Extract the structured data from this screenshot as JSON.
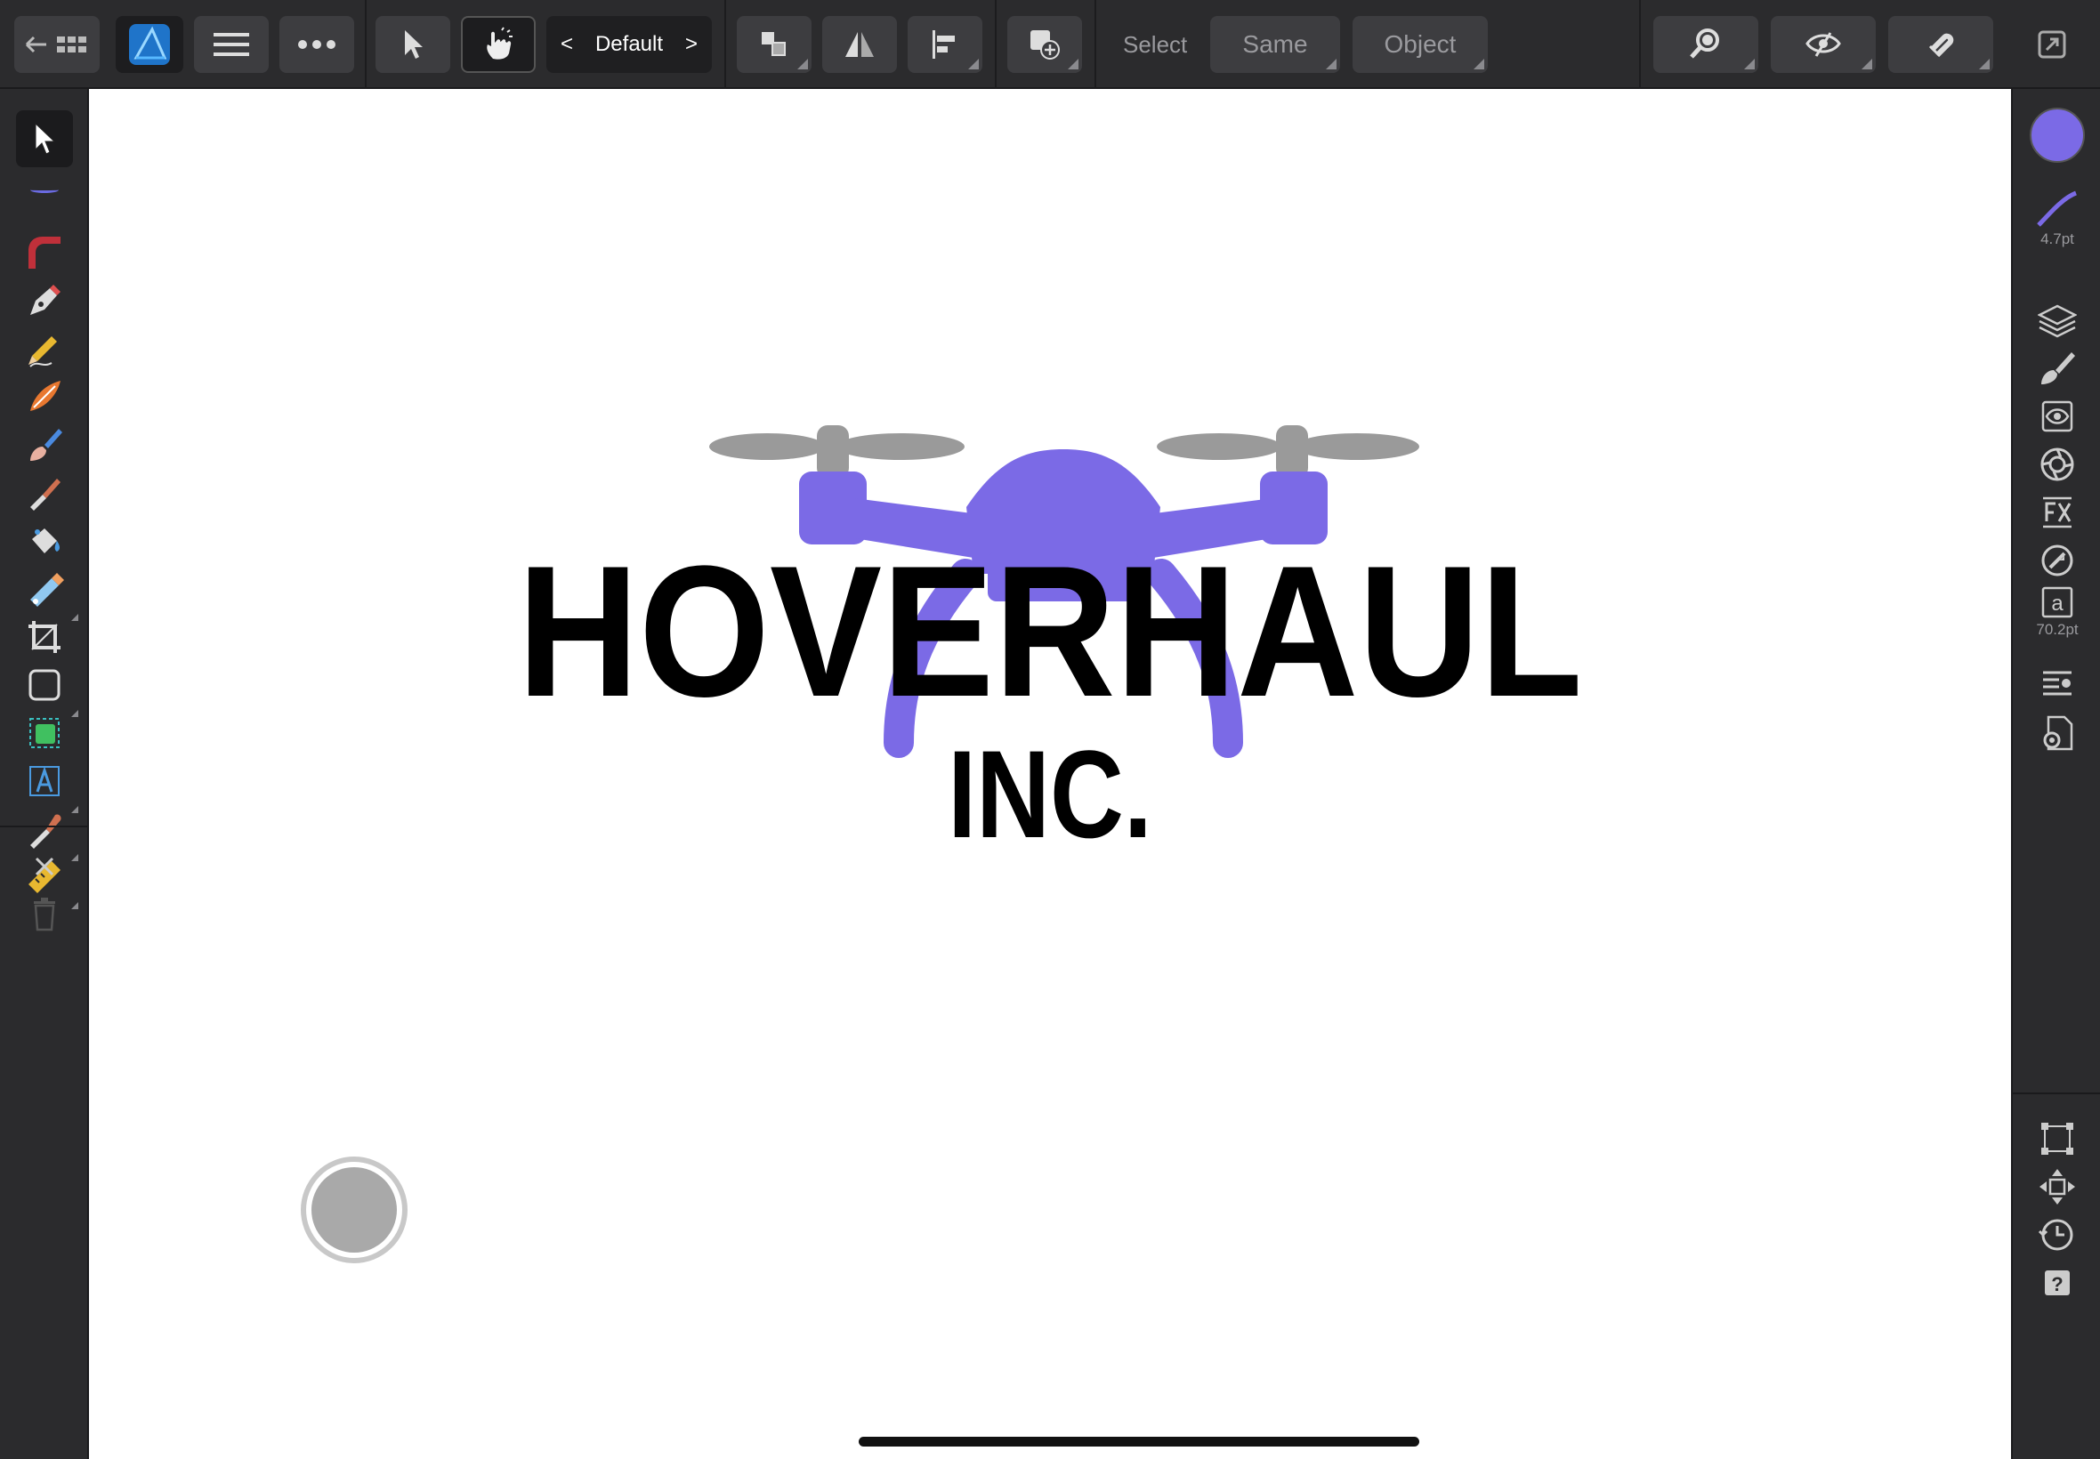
{
  "topbar": {
    "persona_label": "Default",
    "select_label": "Select",
    "same_label": "Same",
    "object_label": "Object"
  },
  "canvas": {
    "logo_title": "HOVERHAUL",
    "logo_subtitle": "INC."
  },
  "rightbar": {
    "stroke_width": "4.7pt",
    "text_size": "70.2pt"
  },
  "colors": {
    "accent_purple": "#7b6ae6",
    "prop_gray": "#9a9a9a"
  }
}
